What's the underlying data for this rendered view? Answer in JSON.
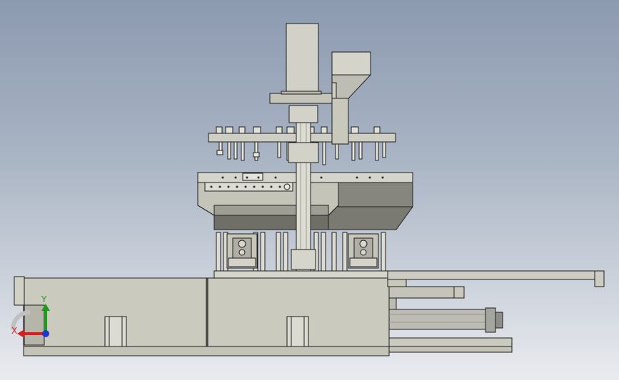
{
  "triad": {
    "x_label": "X",
    "y_label": "Y",
    "x_color": "#d62020",
    "y_color": "#1f9a1f",
    "z_color": "#2038d0"
  },
  "colors": {
    "background_top": "#8c9ab0",
    "background_bottom": "#e9ebef",
    "part_fill": "#c9c8bd",
    "part_dark": "#6f6f68",
    "edge": "#1e1e1e"
  }
}
